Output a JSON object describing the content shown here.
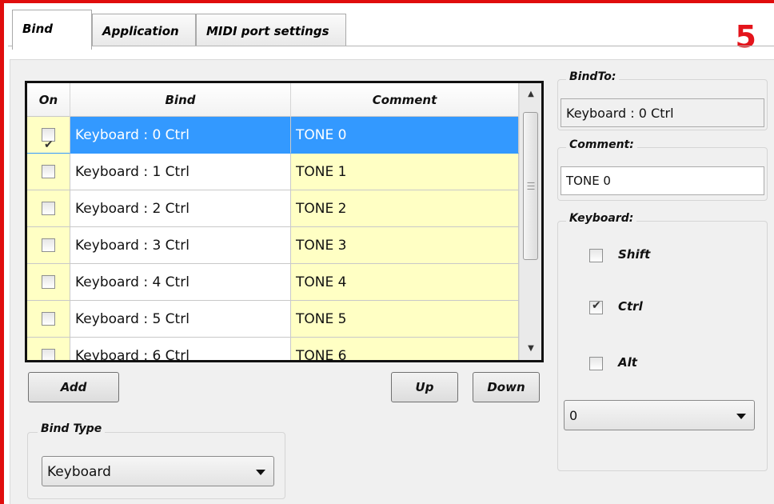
{
  "step_marker": "5",
  "tabs": [
    {
      "label": "Bind",
      "active": true
    },
    {
      "label": "Application",
      "active": false
    },
    {
      "label": "MIDI port settings",
      "active": false
    }
  ],
  "grid": {
    "columns": [
      "On",
      "Bind",
      "Comment"
    ],
    "rows": [
      {
        "on": true,
        "bind": "Keyboard : 0  Ctrl",
        "comment": "TONE 0",
        "selected": true
      },
      {
        "on": false,
        "bind": "Keyboard : 1  Ctrl",
        "comment": "TONE 1",
        "selected": false
      },
      {
        "on": false,
        "bind": "Keyboard : 2  Ctrl",
        "comment": "TONE 2",
        "selected": false
      },
      {
        "on": false,
        "bind": "Keyboard : 3  Ctrl",
        "comment": "TONE 3",
        "selected": false
      },
      {
        "on": false,
        "bind": "Keyboard : 4  Ctrl",
        "comment": "TONE 4",
        "selected": false
      },
      {
        "on": false,
        "bind": "Keyboard : 5  Ctrl",
        "comment": "TONE 5",
        "selected": false
      },
      {
        "on": false,
        "bind": "Keyboard : 6  Ctrl",
        "comment": "TONE 6",
        "selected": false
      }
    ]
  },
  "buttons": {
    "add": "Add",
    "up": "Up",
    "down": "Down"
  },
  "bind_type": {
    "label": "Bind Type",
    "value": "Keyboard"
  },
  "bind_to": {
    "label": "BindTo:",
    "value": "Keyboard : 0  Ctrl"
  },
  "comment": {
    "label": "Comment:",
    "value": "TONE 0"
  },
  "keyboard": {
    "label": "Keyboard:",
    "shift": {
      "label": "Shift",
      "checked": false
    },
    "ctrl": {
      "label": "Ctrl",
      "checked": true
    },
    "alt": {
      "label": "Alt",
      "checked": false
    },
    "key_value": "0"
  },
  "colors": {
    "highlight": "#e00d0d",
    "selection": "#3399ff",
    "comment_bg": "#ffffc4"
  }
}
